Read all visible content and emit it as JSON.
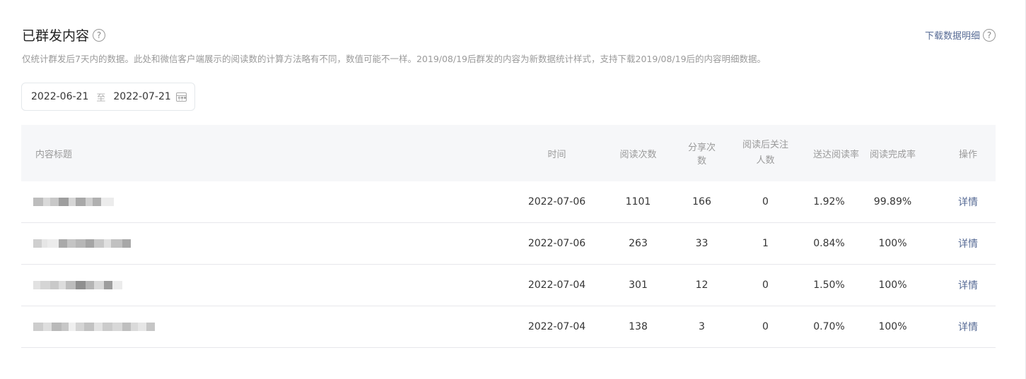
{
  "header": {
    "title": "已群发内容",
    "download_label": "下载数据明细",
    "description": "仅统计群发后7天内的数据。此处和微信客户端展示的阅读数的计算方法略有不同，数值可能不一样。2019/08/19后群发的内容为新数据统计样式，支持下载2019/08/19后的内容明细数据。"
  },
  "date_range": {
    "start": "2022-06-21",
    "separator": "至",
    "end": "2022-07-21"
  },
  "table": {
    "columns": {
      "title": "内容标题",
      "time": "时间",
      "reads": "阅读次数",
      "shares": "分享次数",
      "follows_line1": "阅读后关注",
      "follows_line2": "人数",
      "delivery_rate": "送达阅读率",
      "completion_rate": "阅读完成率",
      "action": "操作"
    },
    "rows": [
      {
        "time": "2022-07-06",
        "reads": "1101",
        "shares": "166",
        "follows": "0",
        "delivery_rate": "1.92%",
        "completion_rate": "99.89%",
        "action": "详情"
      },
      {
        "time": "2022-07-06",
        "reads": "263",
        "shares": "33",
        "follows": "1",
        "delivery_rate": "0.84%",
        "completion_rate": "100%",
        "action": "详情"
      },
      {
        "time": "2022-07-04",
        "reads": "301",
        "shares": "12",
        "follows": "0",
        "delivery_rate": "1.50%",
        "completion_rate": "100%",
        "action": "详情"
      },
      {
        "time": "2022-07-04",
        "reads": "138",
        "shares": "3",
        "follows": "0",
        "delivery_rate": "0.70%",
        "completion_rate": "100%",
        "action": "详情"
      }
    ]
  },
  "icons": {
    "help": "help-icon",
    "calendar": "calendar-icon"
  },
  "colors": {
    "link": "#576b95",
    "muted": "#9a9a9a",
    "header_bg": "#f6f7f9"
  }
}
